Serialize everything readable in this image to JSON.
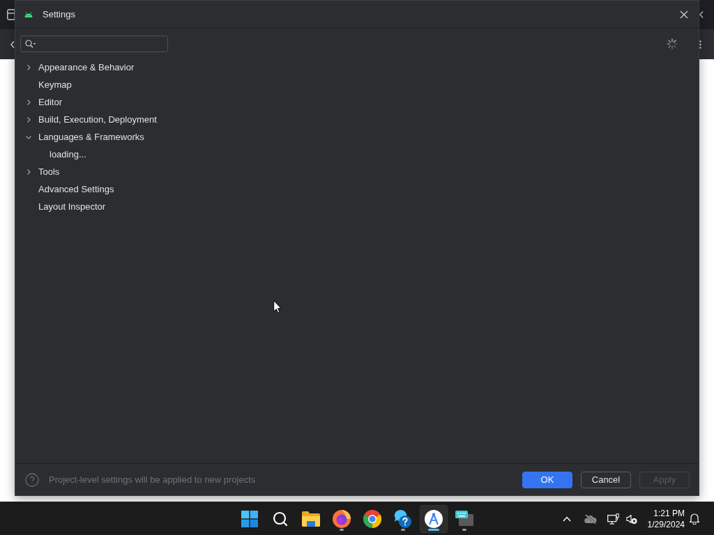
{
  "window": {
    "title": "Settings",
    "loading": true
  },
  "tree": [
    {
      "label": "Appearance & Behavior",
      "kind": "group",
      "expanded": false,
      "selected": false
    },
    {
      "label": "Keymap",
      "kind": "leaf",
      "selected": false
    },
    {
      "label": "Editor",
      "kind": "group",
      "expanded": false,
      "selected": false
    },
    {
      "label": "Build, Execution, Deployment",
      "kind": "group",
      "expanded": false,
      "selected": false
    },
    {
      "label": "Languages & Frameworks",
      "kind": "group",
      "expanded": true,
      "selected": false,
      "children": [
        {
          "label": "loading...",
          "selected": false
        }
      ]
    },
    {
      "label": "Tools",
      "kind": "group",
      "expanded": false,
      "selected": false
    },
    {
      "label": "Advanced Settings",
      "kind": "leaf",
      "selected": false
    },
    {
      "label": "Layout Inspector",
      "kind": "leaf",
      "selected": false
    }
  ],
  "footer": {
    "hint": "Project-level settings will be applied to new projects"
  },
  "buttons": [
    {
      "label": "OK",
      "kind": "primary",
      "disabled": false
    },
    {
      "label": "Cancel",
      "kind": "secondary",
      "disabled": false
    },
    {
      "label": "Apply",
      "kind": "secondary",
      "disabled": true
    }
  ],
  "taskbar": {
    "apps": [
      {
        "kind": "start",
        "running": false,
        "selected": false
      },
      {
        "kind": "search",
        "running": false,
        "selected": false
      },
      {
        "kind": "folder",
        "running": false,
        "selected": false
      },
      {
        "kind": "flame",
        "running": true,
        "selected": false
      },
      {
        "kind": "ring",
        "running": false,
        "selected": false
      },
      {
        "kind": "help",
        "running": true,
        "selected": false
      },
      {
        "kind": "compass",
        "running": true,
        "selected": true
      },
      {
        "kind": "keyboard",
        "running": true,
        "selected": false
      }
    ],
    "tray": {
      "muted": true
    },
    "clock": {
      "time": "1:21 PM",
      "date": "1/29/2024"
    }
  }
}
